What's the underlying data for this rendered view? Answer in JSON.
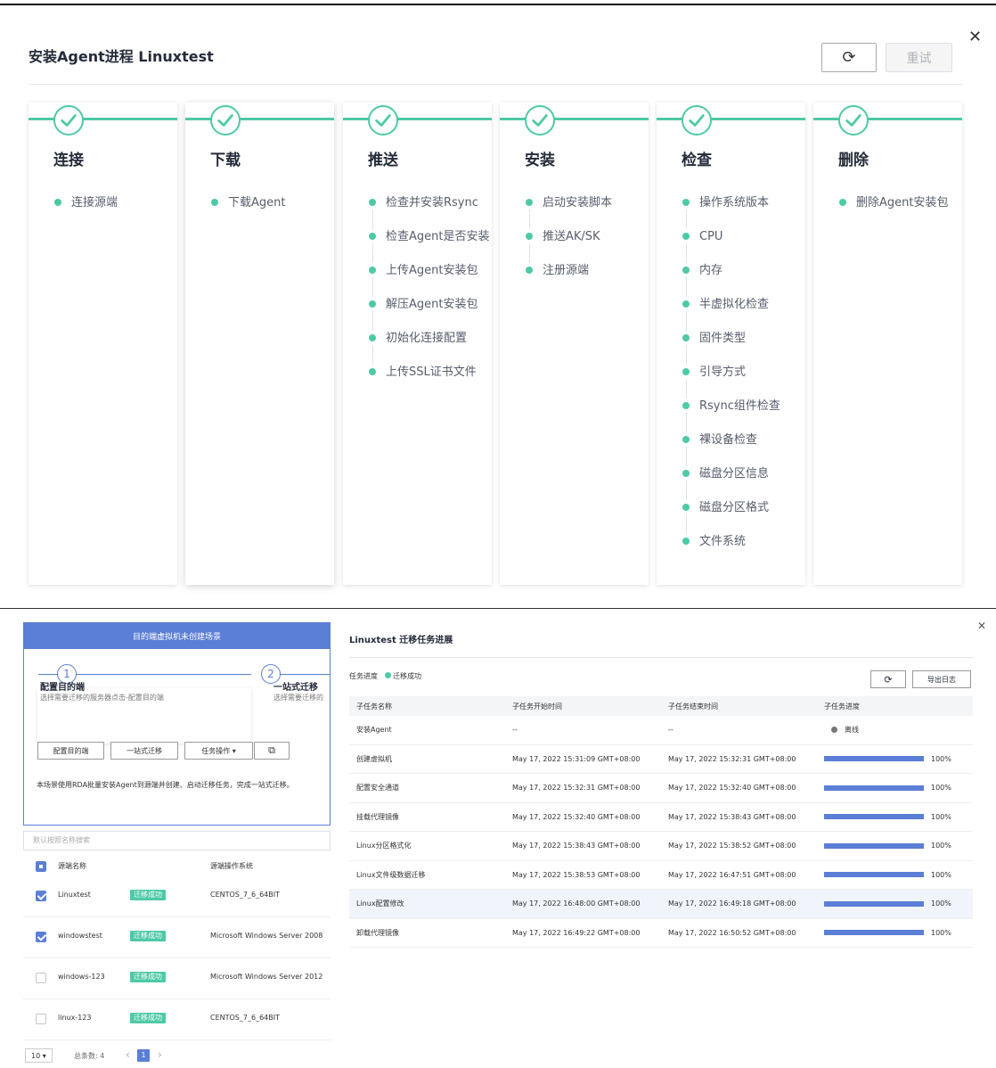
{
  "dialog": {
    "title": "安装Agent进程 Linuxtest",
    "refresh_icon": "refresh-icon",
    "retry_label": "重试",
    "close_icon": "close-icon"
  },
  "stages": [
    {
      "title": "连接",
      "steps": [
        "连接源端"
      ]
    },
    {
      "title": "下载",
      "steps": [
        "下载Agent"
      ]
    },
    {
      "title": "推送",
      "steps": [
        "检查并安装Rsync",
        "检查Agent是否安装",
        "上传Agent安装包",
        "解压Agent安装包",
        "初始化连接配置",
        "上传SSL证书文件"
      ]
    },
    {
      "title": "安装",
      "steps": [
        "启动安装脚本",
        "推送AK/SK",
        "注册源端"
      ]
    },
    {
      "title": "检查",
      "steps": [
        "操作系统版本",
        "CPU",
        "内存",
        "半虚拟化检查",
        "固件类型",
        "引导方式",
        "Rsync组件检查",
        "裸设备检查",
        "磁盘分区信息",
        "磁盘分区格式",
        "文件系统"
      ]
    },
    {
      "title": "删除",
      "steps": [
        "删除Agent安装包"
      ]
    }
  ],
  "left_panel": {
    "header": "目的端虚拟机未创建场景",
    "step1_num": "1",
    "step1_title": "配置目的端",
    "step1_desc": "选择需要迁移的服务器点击-配置目的端",
    "step2_num": "2",
    "step2_title": "一站式迁移",
    "step2_desc": "选择需要迁移的",
    "btn_config": "配置目的端",
    "btn_onestop": "一站式迁移",
    "btn_task": "任务操作 ▾",
    "btn_export_icon": "export-icon",
    "description": "本场景使用RDA批量安装Agent到源端并创建、启动迁移任务，完成一站式迁移。",
    "search_placeholder": "默认按照名称搜索",
    "col_name": "源端名称",
    "col_os": "源端操作系统",
    "rows": [
      {
        "name": "Linuxtest",
        "status": "迁移成功",
        "os": "CENTOS_7_6_64BIT",
        "checked": true
      },
      {
        "name": "windowstest",
        "status": "迁移成功",
        "os": "Microsoft Windows Server 2008",
        "checked": true
      },
      {
        "name": "windows-123",
        "status": "迁移成功",
        "os": "Microsoft Windows Server 2012",
        "checked": false
      },
      {
        "name": "linux-123",
        "status": "迁移成功",
        "os": "CENTOS_7_6_64BIT",
        "checked": false
      }
    ],
    "page_size": "10 ▾",
    "total": "总条数: 4",
    "prev": "‹",
    "page": "1",
    "next": "›"
  },
  "right_panel": {
    "title": "Linuxtest 迁移任务进展",
    "close_icon": "close-icon",
    "progress_label": "任务进度",
    "progress_status": "迁移成功",
    "export_label": "导出日志",
    "columns": [
      "子任务名称",
      "子任务开始时间",
      "子任务结束时间",
      "子任务进度"
    ],
    "rows": [
      {
        "name": "安装Agent",
        "start": "--",
        "end": "--",
        "progress": "离线",
        "offline": true
      },
      {
        "name": "创建虚拟机",
        "start": "May 17, 2022 15:31:09 GMT+08:00",
        "end": "May 17, 2022 15:32:31 GMT+08:00",
        "progress": "100%"
      },
      {
        "name": "配置安全通道",
        "start": "May 17, 2022 15:32:31 GMT+08:00",
        "end": "May 17, 2022 15:32:40 GMT+08:00",
        "progress": "100%"
      },
      {
        "name": "挂载代理镜像",
        "start": "May 17, 2022 15:32:40 GMT+08:00",
        "end": "May 17, 2022 15:38:43 GMT+08:00",
        "progress": "100%"
      },
      {
        "name": "Linux分区格式化",
        "start": "May 17, 2022 15:38:43 GMT+08:00",
        "end": "May 17, 2022 15:38:52 GMT+08:00",
        "progress": "100%"
      },
      {
        "name": "Linux文件级数据迁移",
        "start": "May 17, 2022 15:38:53 GMT+08:00",
        "end": "May 17, 2022 16:47:51 GMT+08:00",
        "progress": "100%"
      },
      {
        "name": "Linux配置修改",
        "start": "May 17, 2022 16:48:00 GMT+08:00",
        "end": "May 17, 2022 16:49:18 GMT+08:00",
        "progress": "100%",
        "highlight": true
      },
      {
        "name": "卸载代理镜像",
        "start": "May 17, 2022 16:49:22 GMT+08:00",
        "end": "May 17, 2022 16:50:52 GMT+08:00",
        "progress": "100%"
      }
    ]
  },
  "colors": {
    "success": "#4ec9a6",
    "primary": "#5b7ed6"
  }
}
